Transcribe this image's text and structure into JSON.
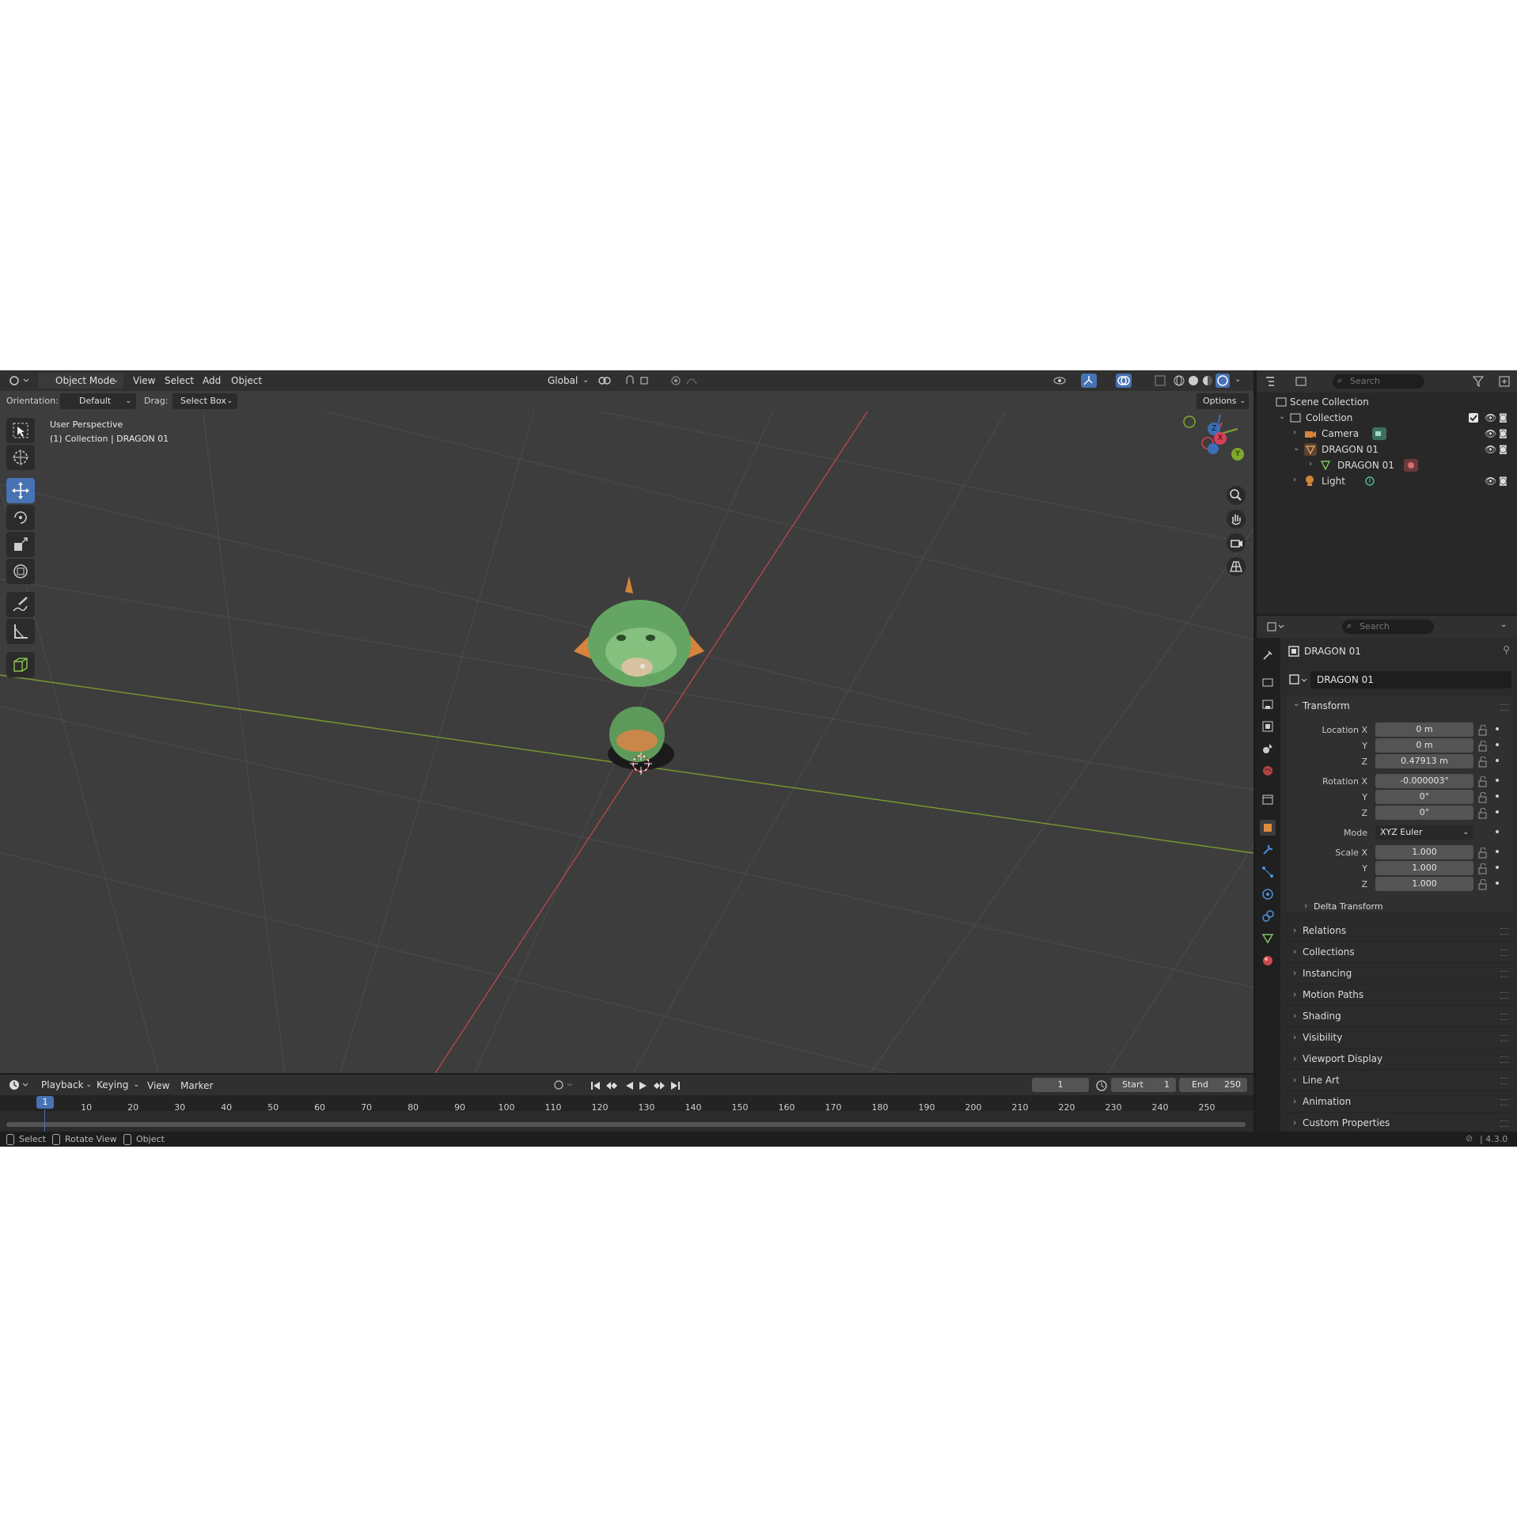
{
  "header": {
    "mode": "Object Mode",
    "menus": [
      "View",
      "Select",
      "Add",
      "Object"
    ],
    "orientation_global": "Global",
    "orientation_label": "Orientation:",
    "orientation_value": "Default",
    "drag_label": "Drag:",
    "drag_value": "Select Box",
    "options": "Options"
  },
  "viewport": {
    "overlay_line1": "User Perspective",
    "overlay_line2": "(1) Collection | DRAGON 01",
    "gizmo": {
      "x": "X",
      "y": "Y",
      "z": "Z"
    },
    "grid_visible": true
  },
  "outliner": {
    "search_placeholder": "Search",
    "scene_collection": "Scene Collection",
    "collection": "Collection",
    "items": [
      {
        "label": "Camera"
      },
      {
        "label": "DRAGON 01"
      },
      {
        "label": "DRAGON 01"
      },
      {
        "label": "Light"
      }
    ]
  },
  "properties": {
    "search_placeholder": "Search",
    "object_name": "DRAGON 01",
    "object_field": "DRAGON 01",
    "transform_title": "Transform",
    "location_label": "Location X",
    "rotation_label": "Rotation X",
    "scale_label": "Scale X",
    "axis_y": "Y",
    "axis_z": "Z",
    "location": [
      "0 m",
      "0 m",
      "0.47913 m"
    ],
    "rotation": [
      "-0.000003°",
      "0°",
      "0°"
    ],
    "mode_label": "Mode",
    "mode_value": "XYZ Euler",
    "scale": [
      "1.000",
      "1.000",
      "1.000"
    ],
    "delta_transform": "Delta Transform",
    "sections": [
      "Relations",
      "Collections",
      "Instancing",
      "Motion Paths",
      "Shading",
      "Visibility",
      "Viewport Display",
      "Line Art",
      "Animation",
      "Custom Properties"
    ]
  },
  "timeline": {
    "menus": [
      "Playback",
      "Keying",
      "View",
      "Marker"
    ],
    "current_frame": "1",
    "start_label": "Start",
    "start_value": "1",
    "end_label": "End",
    "end_value": "250",
    "playhead": "1",
    "ticks": [
      "10",
      "20",
      "30",
      "40",
      "50",
      "60",
      "70",
      "80",
      "90",
      "100",
      "110",
      "120",
      "130",
      "140",
      "150",
      "160",
      "170",
      "180",
      "190",
      "200",
      "210",
      "220",
      "230",
      "240",
      "250"
    ]
  },
  "statusbar": {
    "items": [
      "Select",
      "Rotate View",
      "Object"
    ],
    "version": "4.3.0"
  }
}
